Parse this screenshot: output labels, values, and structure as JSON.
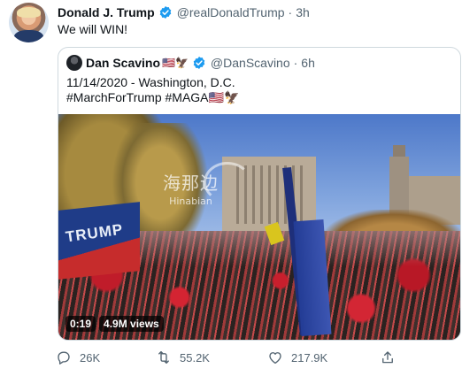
{
  "author": {
    "name": "Donald J. Trump",
    "handle": "@realDonaldTrump",
    "separator": "·",
    "time": "3h"
  },
  "tweet": {
    "text": "We will WIN!"
  },
  "quoted": {
    "name": "Dan Scavino",
    "name_emoji": "🇺🇸🦅",
    "handle": "@DanScavino",
    "separator": "·",
    "time": "6h",
    "line1": "11/14/2020 - Washington, D.C.",
    "line2": "#MarchForTrump #MAGA🇺🇸🦅",
    "video": {
      "duration": "0:19",
      "views": "4.9M views",
      "flag_text": "TRUMP",
      "watermark_cn": "海那边",
      "watermark_en": "Hinabian"
    }
  },
  "actions": {
    "replies": "26K",
    "retweets": "55.2K",
    "likes": "217.9K"
  },
  "colors": {
    "verified": "#1d9bf0",
    "muted": "#536471",
    "border": "#cfd9de"
  },
  "icons": [
    "verified-icon",
    "reply-icon",
    "retweet-icon",
    "like-icon",
    "share-icon"
  ]
}
